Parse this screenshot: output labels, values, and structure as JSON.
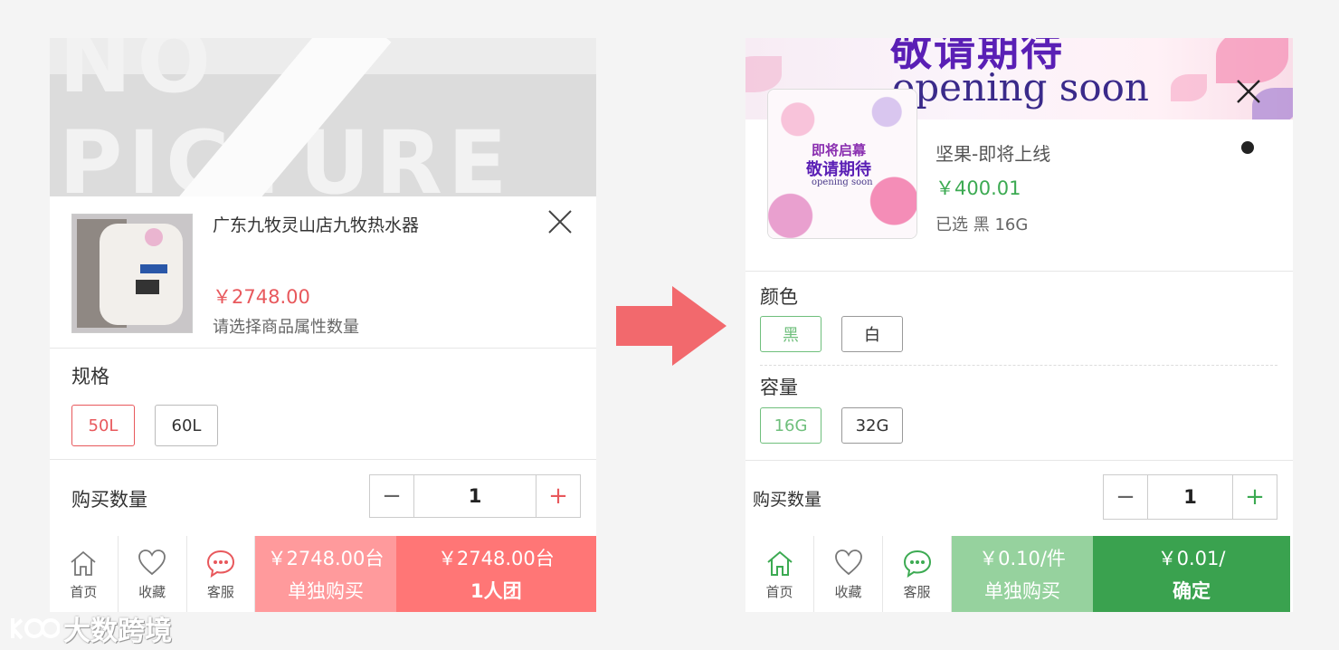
{
  "left": {
    "product": {
      "name": "广东九牧灵山店九牧热水器",
      "price": "￥2748.00",
      "hint": "请选择商品属性数量"
    },
    "spec": {
      "label": "规格",
      "options": [
        "50L",
        "60L"
      ],
      "selected": "50L"
    },
    "quantity": {
      "label": "购买数量",
      "value": "1",
      "minus": "−",
      "plus": "+"
    },
    "footer": {
      "nav": [
        "首页",
        "收藏",
        "客服"
      ],
      "buy_single": {
        "price": "￥2748.00台",
        "label": "单独购买"
      },
      "buy_group": {
        "price": "￥2748.00台",
        "label": "1人团"
      }
    },
    "colors": {
      "accent": "#e8585c",
      "single_bg": "#ff9a9c",
      "group_bg": "#ff7676"
    }
  },
  "right": {
    "banner": {
      "cn": "敬请期待",
      "en": "opening soon"
    },
    "thumb": {
      "cn1": "即将启幕",
      "cn2": "敬请期待",
      "en": "opening soon"
    },
    "product": {
      "name": "坚果-即将上线",
      "price": "￥400.01",
      "selected": "已选 黑 16G"
    },
    "color": {
      "label": "颜色",
      "options": [
        "黑",
        "白"
      ],
      "selected": "黑"
    },
    "capacity": {
      "label": "容量",
      "options": [
        "16G",
        "32G"
      ],
      "selected": "16G"
    },
    "quantity": {
      "label": "购买数量",
      "value": "1",
      "minus": "−",
      "plus": "+"
    },
    "footer": {
      "nav": [
        "首页",
        "收藏",
        "客服"
      ],
      "buy_single": {
        "price": "￥0.10/件",
        "label": "单独购买"
      },
      "confirm": {
        "price": "￥0.01/",
        "label": "确定"
      }
    },
    "colors": {
      "accent": "#3caa52",
      "single_bg": "#96d29e",
      "confirm_bg": "#3aa24f"
    }
  },
  "watermark": {
    "text": "大数跨境"
  },
  "icons": [
    "home-icon",
    "heart-icon",
    "chat-icon",
    "close-icon",
    "arrow-right-icon"
  ]
}
